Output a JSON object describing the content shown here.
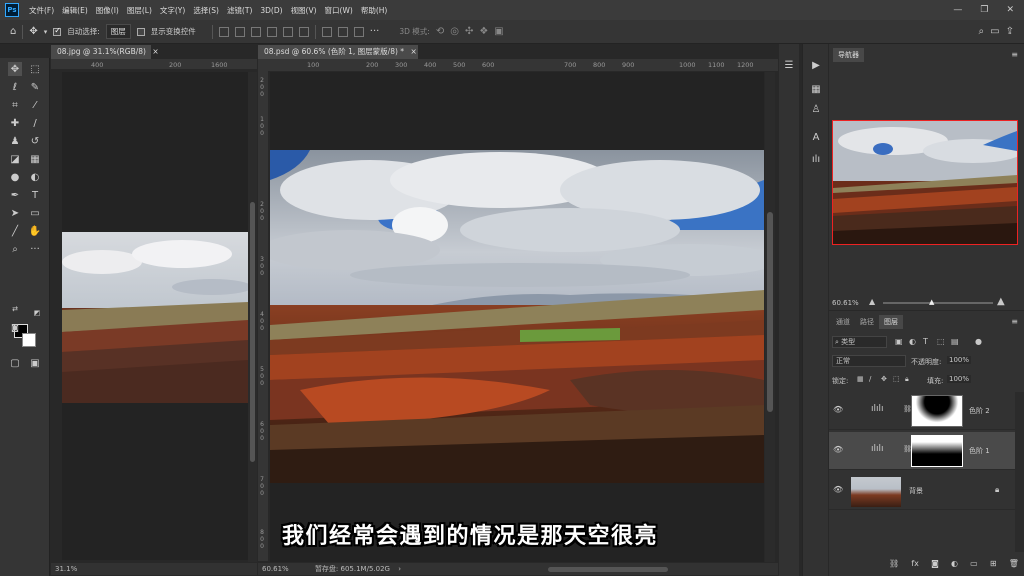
{
  "menubar": {
    "logo": "Ps",
    "items": [
      "文件(F)",
      "编辑(E)",
      "图像(I)",
      "图层(L)",
      "文字(Y)",
      "选择(S)",
      "滤镜(T)",
      "3D(D)",
      "视图(V)",
      "窗口(W)",
      "帮助(H)"
    ],
    "controls": [
      "—",
      "❐",
      "✕"
    ]
  },
  "options": {
    "auto_select_label": "自动选择:",
    "auto_select_value": "图层",
    "transform_label": "显示变换控件",
    "mode_3d": "3D 模式:"
  },
  "tabs": {
    "doc1": "08.jpg @ 31.1%(RGB/8)",
    "doc1_close": "×",
    "doc2": "08.psd @ 60.6% (色阶 1, 图层蒙版/8) *",
    "doc2_close": "×"
  },
  "ruler1": {
    "marks": [
      "400",
      "200",
      "1600"
    ]
  },
  "ruler2": {
    "marks": [
      "100",
      "200",
      "300",
      "400",
      "500",
      "600",
      "700",
      "800",
      "900",
      "1000",
      "1100",
      "1200"
    ]
  },
  "vruler2": {
    "marks": [
      "2\n0\n0",
      "1\n0\n0",
      "2\n0\n0",
      "3\n0\n0",
      "4\n0\n0",
      "5\n0\n0",
      "6\n0\n0",
      "7\n0\n0",
      "8\n0\n0"
    ]
  },
  "status1": {
    "zoom": "31.1%"
  },
  "status2": {
    "zoom": "60.61%",
    "info": "暂存盘: 605.1M/5.02G"
  },
  "navigator": {
    "tab": "导航器",
    "zoom": "60.61%"
  },
  "layers": {
    "tabs": [
      "通道",
      "路径",
      "图层"
    ],
    "filter_label": "类型",
    "blend_mode": "正常",
    "opacity_label": "不透明度:",
    "opacity_value": "100%",
    "lock_label": "锁定:",
    "fill_label": "填充:",
    "fill_value": "100%",
    "items": [
      {
        "name": "色阶 2",
        "visible": true,
        "selected": false
      },
      {
        "name": "色阶 1",
        "visible": true,
        "selected": true
      },
      {
        "name": "背景",
        "visible": true,
        "selected": false,
        "locked": true
      }
    ],
    "footer_icons": [
      "link-icon",
      "fx-icon",
      "mask-icon",
      "adjustment-icon",
      "group-icon",
      "new-layer-icon",
      "trash-icon"
    ]
  },
  "subtitle": "我们经常会遇到的情况是那天空很亮"
}
